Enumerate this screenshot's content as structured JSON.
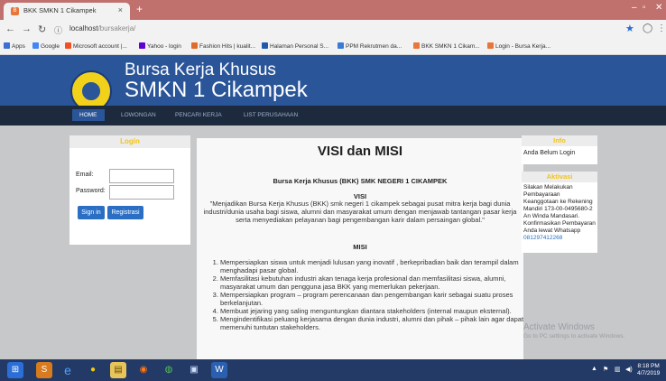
{
  "browser": {
    "tab_title": "BKK SMKN 1 Cikampek",
    "tab_close": "×",
    "new_tab": "+",
    "url_host": "localhost",
    "url_path": "/bursakerja/",
    "bookmarks": [
      {
        "label": "Apps",
        "color": "#3b6fd6"
      },
      {
        "label": "Google",
        "color": "#4285f4"
      },
      {
        "label": "Microsoft account |...",
        "color": "#f25022"
      },
      {
        "label": "Yahoo - login",
        "color": "#6001d2"
      },
      {
        "label": "Fashion Hits | kualit...",
        "color": "#e06c2b"
      },
      {
        "label": "Halaman Personal S...",
        "color": "#1f5aa8"
      },
      {
        "label": "PPM Rekrutmen da...",
        "color": "#3a7bd5"
      },
      {
        "label": "BKK SMKN 1 Cikam...",
        "color": "#e8753a"
      },
      {
        "label": "Login - Bursa Kerja...",
        "color": "#e8753a"
      }
    ]
  },
  "site": {
    "title_line1": "Bursa Kerja Khusus",
    "title_line2": "SMKN 1 Cikampek",
    "menu": [
      "HOME",
      "LOWONGAN",
      "PENCARI KERJA",
      "LIST PERUSAHAAN"
    ]
  },
  "login": {
    "heading": "Login",
    "email_label": "Email:",
    "password_label": "Password:",
    "signin_label": "Sign in",
    "register_label": "Registrasi"
  },
  "main": {
    "title": "VISI dan MISI",
    "subtitle": "Bursa Kerja Khusus (BKK) SMK NEGERI 1 CIKAMPEK",
    "visi_heading": "VISI",
    "visi_text": "\"Menjadikan Bursa Kerja Khusus (BKK) smk negeri 1 cikampek sebagai pusat mitra kerja bagi dunia industri/dunia usaha bagi siswa, alumni dan masyarakat umum dengan menjawab tantangan pasar kerja serta menyediakan pelayanan bagi pengembangan karir dalam persaingan global.\"",
    "misi_heading": "MISI",
    "misi_items": [
      "Mempersiapkan siswa untuk menjadi lulusan yang inovatif , berkepribadian baik dan terampil dalam menghadapi pasar global.",
      "Memfasilitasi kebutuhan industri akan tenaga kerja profesional dan memfasilitasi siswa, alumni, masyarakat umum dan pengguna jasa BKK yang memerlukan pekerjaan.",
      "Mempersiapkan program – program perencanaan dan pengembangan karir sebagai suatu proses berkelanjutan.",
      "Membuat jejaring yang saling menguntungkan diantara stakeholders (internal maupun eksternal).",
      "Mengindentifikasi peluang kerjasama dengan dunia industri, alumni dan pihak – pihak lain agar dapat memenuhi tuntutan stakeholders."
    ]
  },
  "sidebar": {
    "info_heading": "Info",
    "info_text": "Anda Belum Login",
    "aktivasi_heading": "Aktivasi",
    "aktivasi_text": "Silakan Melakukan Pembayaraan Keanggotaan ke Rekening Mandiri 173-00-0495680-2 An Winda Mandasari. Konfirmasikan Pembayaran Anda lewat Whatsapp",
    "whatsapp_number": "081297412268"
  },
  "windows": {
    "activate_title": "Activate Windows",
    "activate_sub": "Go to PC settings to activate Windows.",
    "clock_time": "8:18 PM",
    "clock_date": "4/7/2019"
  },
  "colors": {
    "header_blue": "#2a5598",
    "menu_dark": "#1d2a3e",
    "accent_yellow": "#f1c31b",
    "button_blue": "#2a6fc4",
    "tab_strip": "#c0706d"
  }
}
